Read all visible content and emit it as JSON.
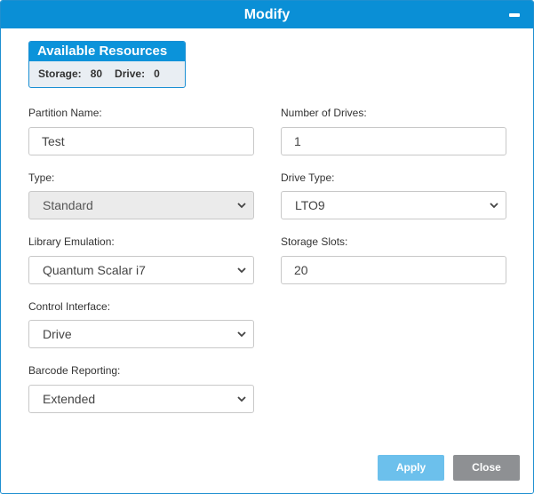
{
  "dialog": {
    "title": "Modify",
    "minimize_icon": "minimize-icon"
  },
  "resources": {
    "title": "Available Resources",
    "storage_label": "Storage:",
    "storage_value": "80",
    "drive_label": "Drive:",
    "drive_value": "0"
  },
  "form": {
    "partition_name": {
      "label": "Partition Name:",
      "value": "Test"
    },
    "number_of_drives": {
      "label": "Number of Drives:",
      "value": "1"
    },
    "type": {
      "label": "Type:",
      "value": "Standard",
      "disabled": true
    },
    "drive_type": {
      "label": "Drive Type:",
      "value": "LTO9"
    },
    "library_emulation": {
      "label": "Library Emulation:",
      "value": "Quantum Scalar i7"
    },
    "storage_slots": {
      "label": "Storage Slots:",
      "value": "20"
    },
    "control_interface": {
      "label": "Control Interface:",
      "value": "Drive"
    },
    "barcode_reporting": {
      "label": "Barcode Reporting:",
      "value": "Extended"
    }
  },
  "buttons": {
    "apply": "Apply",
    "close": "Close"
  },
  "colors": {
    "titlebar": "#0a8fd6",
    "apply": "#6cc0ec",
    "close": "#8e9093"
  }
}
